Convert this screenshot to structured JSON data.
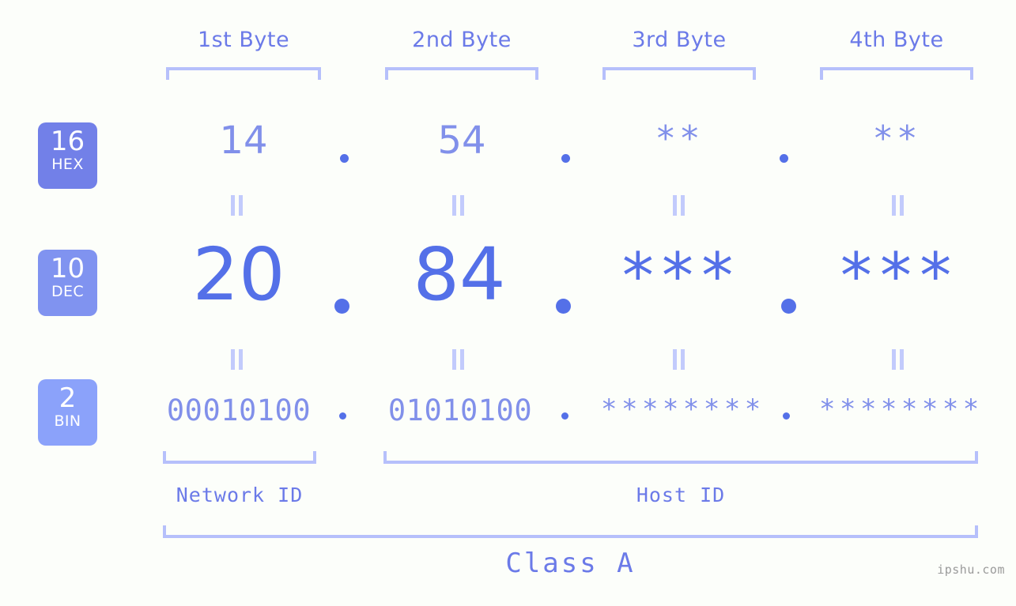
{
  "watermark": "ipshu.com",
  "colors": {
    "background": "#fcfefa",
    "bracket": "#b6c0fb",
    "accent_light": "#8190ea",
    "accent_dark": "#5470e8",
    "label": "#6b7ae8",
    "equals": "#c2cbfc",
    "badge_hex": "#7280e8",
    "badge_dec": "#8093f0",
    "badge_bin": "#8ba2fa",
    "watermark": "#9a9a9a"
  },
  "byte_headers": [
    {
      "label": "1st Byte"
    },
    {
      "label": "2nd Byte"
    },
    {
      "label": "3rd Byte"
    },
    {
      "label": "4th Byte"
    }
  ],
  "bases": [
    {
      "number": "16",
      "name": "HEX"
    },
    {
      "number": "10",
      "name": "DEC"
    },
    {
      "number": "2",
      "name": "BIN"
    }
  ],
  "rows": {
    "hex": {
      "base_number": "16",
      "base_name": "HEX",
      "values": [
        "14",
        "54",
        "**",
        "**"
      ],
      "separator": "."
    },
    "dec": {
      "base_number": "10",
      "base_name": "DEC",
      "values": [
        "20",
        "84",
        "***",
        "***"
      ],
      "separator": "."
    },
    "bin": {
      "base_number": "2",
      "base_name": "BIN",
      "values": [
        "00010100",
        "01010100",
        "********",
        "********"
      ],
      "separator": "."
    }
  },
  "equals_symbol": "=",
  "segments": {
    "network_id": "Network ID",
    "host_id": "Host ID",
    "class": "Class A"
  }
}
